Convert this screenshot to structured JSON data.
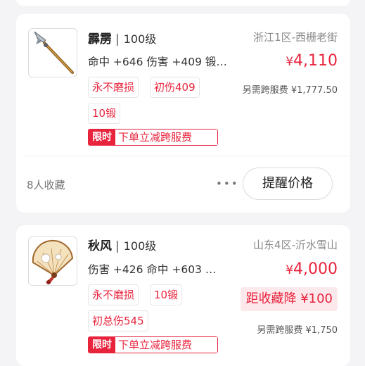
{
  "listings": [
    {
      "name": "霹雳",
      "level": "100级",
      "server": "浙江1区-西栅老街",
      "stats": "命中 +646 伤害 +409 锻…",
      "price_symbol": "¥",
      "price_value": "4,110",
      "tags": [
        "永不磨损",
        "初伤409",
        "10锻"
      ],
      "cross_fee": "另需跨服费 ¥1,777.50",
      "promo_badge": "限时",
      "promo_text": "下单立减跨服费",
      "favorites": "8人收藏",
      "more_label": "•••",
      "remind_button": "提醒价格",
      "icon": "spear-icon"
    },
    {
      "name": "秋风",
      "level": "100级",
      "server": "山东4区-沂水雪山",
      "stats": "伤害 +426 命中 +603 …",
      "price_symbol": "¥",
      "price_value": "4,000",
      "price_drop": "距收藏降 ¥100",
      "tags": [
        "永不磨损",
        "10锻",
        "初总伤545"
      ],
      "cross_fee": "另需跨服费 ¥1,750",
      "promo_badge": "限时",
      "promo_text": "下单立减跨服费",
      "icon": "fan-icon"
    }
  ],
  "colors": {
    "accent": "#e8243d",
    "background": "#f4f4f6",
    "card": "#ffffff",
    "drop_bg": "#fde9eb"
  }
}
